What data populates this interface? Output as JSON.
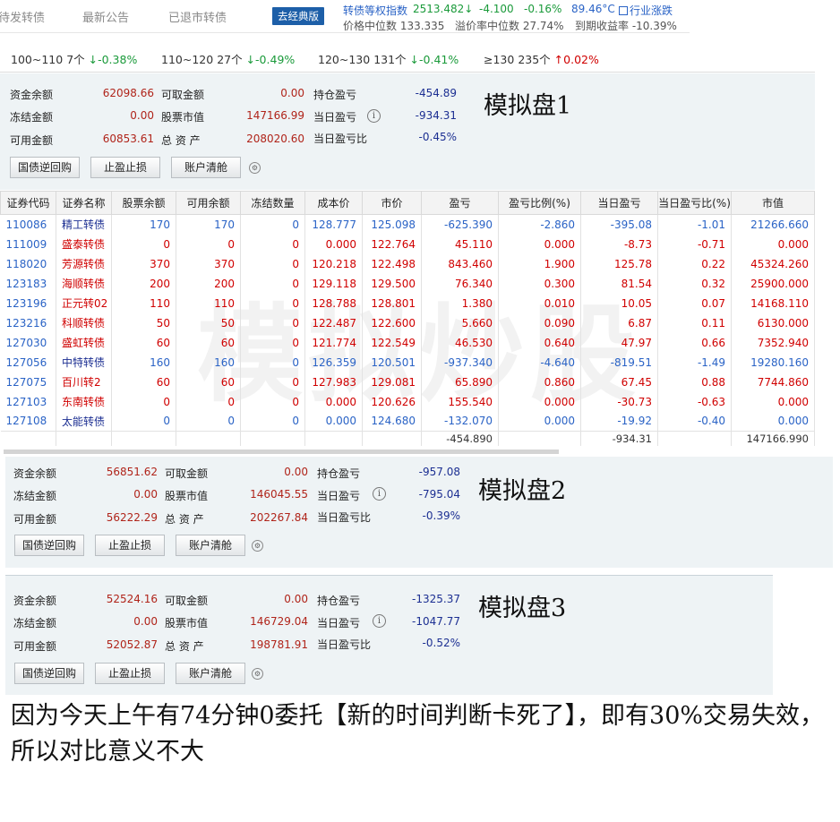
{
  "nav": {
    "tabs": [
      "待发转债",
      "最新公告",
      "已退市转债"
    ],
    "classic_button": "去经典版"
  },
  "index": {
    "label": "转债等权指数",
    "value": "2513.482↓",
    "change": "-4.100",
    "change_pct": "-0.16%",
    "temperature": "89.46°C",
    "industry_link": "行业涨跌",
    "median_price_label": "价格中位数 133.335",
    "premium_label": "溢价率中位数 27.74%",
    "ytm_label": "到期收益率 -10.39%"
  },
  "distribution": [
    {
      "range": "100~110",
      "count": "7个",
      "change": "↓-0.38%",
      "dir": "down"
    },
    {
      "range": "110~120",
      "count": "27个",
      "change": "↓-0.49%",
      "dir": "down"
    },
    {
      "range": "120~130",
      "count": "131个",
      "change": "↓-0.41%",
      "dir": "down"
    },
    {
      "range": "≥130",
      "count": "235个",
      "change": "↑0.02%",
      "dir": "up"
    }
  ],
  "labels": {
    "fund_balance": "资金余额",
    "withdrawable": "可取金额",
    "position_pl": "持仓盈亏",
    "frozen": "冻结金额",
    "stock_value": "股票市值",
    "today_pl": "当日盈亏",
    "available": "可用金额",
    "total_assets": "总 资 产",
    "today_pl_ratio": "当日盈亏比",
    "btn_repo": "国债逆回购",
    "btn_stop": "止盈止损",
    "btn_clear": "账户清舱"
  },
  "panels": [
    {
      "title": "模拟盘1",
      "fund_balance": "62098.66",
      "withdrawable": "0.00",
      "position_pl": "-454.89",
      "frozen": "0.00",
      "stock_value": "147166.99",
      "today_pl": "-934.31",
      "available": "60853.61",
      "total_assets": "208020.60",
      "today_pl_ratio": "-0.45%"
    },
    {
      "title": "模拟盘2",
      "fund_balance": "56851.62",
      "withdrawable": "0.00",
      "position_pl": "-957.08",
      "frozen": "0.00",
      "stock_value": "146045.55",
      "today_pl": "-795.04",
      "available": "56222.29",
      "total_assets": "202267.84",
      "today_pl_ratio": "-0.39%"
    },
    {
      "title": "模拟盘3",
      "fund_balance": "52524.16",
      "withdrawable": "0.00",
      "position_pl": "-1325.37",
      "frozen": "0.00",
      "stock_value": "146729.04",
      "today_pl": "-1047.77",
      "available": "52052.87",
      "total_assets": "198781.91",
      "today_pl_ratio": "-0.52%"
    }
  ],
  "table": {
    "headers": [
      "证券代码",
      "证券名称",
      "股票余额",
      "可用余额",
      "冻结数量",
      "成本价",
      "市价",
      "盈亏",
      "盈亏比例(%)",
      "当日盈亏",
      "当日盈亏比(%)",
      "市值"
    ],
    "rows": [
      {
        "code": "110086",
        "name": "精工转债",
        "bal": "170",
        "avail": "170",
        "frozen": "0",
        "cost": "128.777",
        "price": "125.098",
        "pl": "-625.390",
        "pl_pct": "-2.860",
        "day_pl": "-395.08",
        "day_pct": "-1.01",
        "value": "21266.660",
        "color": "blue"
      },
      {
        "code": "111009",
        "name": "盛泰转债",
        "bal": "0",
        "avail": "0",
        "frozen": "0",
        "cost": "0.000",
        "price": "122.764",
        "pl": "45.110",
        "pl_pct": "0.000",
        "day_pl": "-8.73",
        "day_pct": "-0.71",
        "value": "0.000",
        "color": "red"
      },
      {
        "code": "118020",
        "name": "芳源转债",
        "bal": "370",
        "avail": "370",
        "frozen": "0",
        "cost": "120.218",
        "price": "122.498",
        "pl": "843.460",
        "pl_pct": "1.900",
        "day_pl": "125.78",
        "day_pct": "0.22",
        "value": "45324.260",
        "color": "red"
      },
      {
        "code": "123183",
        "name": "海顺转债",
        "bal": "200",
        "avail": "200",
        "frozen": "0",
        "cost": "129.118",
        "price": "129.500",
        "pl": "76.340",
        "pl_pct": "0.300",
        "day_pl": "81.54",
        "day_pct": "0.32",
        "value": "25900.000",
        "color": "red"
      },
      {
        "code": "123196",
        "name": "正元转02",
        "bal": "110",
        "avail": "110",
        "frozen": "0",
        "cost": "128.788",
        "price": "128.801",
        "pl": "1.380",
        "pl_pct": "0.010",
        "day_pl": "10.05",
        "day_pct": "0.07",
        "value": "14168.110",
        "color": "red"
      },
      {
        "code": "123216",
        "name": "科顺转债",
        "bal": "50",
        "avail": "50",
        "frozen": "0",
        "cost": "122.487",
        "price": "122.600",
        "pl": "5.660",
        "pl_pct": "0.090",
        "day_pl": "6.87",
        "day_pct": "0.11",
        "value": "6130.000",
        "color": "red"
      },
      {
        "code": "127030",
        "name": "盛虹转债",
        "bal": "60",
        "avail": "60",
        "frozen": "0",
        "cost": "121.774",
        "price": "122.549",
        "pl": "46.530",
        "pl_pct": "0.640",
        "day_pl": "47.97",
        "day_pct": "0.66",
        "value": "7352.940",
        "color": "red"
      },
      {
        "code": "127056",
        "name": "中特转债",
        "bal": "160",
        "avail": "160",
        "frozen": "0",
        "cost": "126.359",
        "price": "120.501",
        "pl": "-937.340",
        "pl_pct": "-4.640",
        "day_pl": "-819.51",
        "day_pct": "-1.49",
        "value": "19280.160",
        "color": "blue"
      },
      {
        "code": "127075",
        "name": "百川转2",
        "bal": "60",
        "avail": "60",
        "frozen": "0",
        "cost": "127.983",
        "price": "129.081",
        "pl": "65.890",
        "pl_pct": "0.860",
        "day_pl": "67.45",
        "day_pct": "0.88",
        "value": "7744.860",
        "color": "red"
      },
      {
        "code": "127103",
        "name": "东南转债",
        "bal": "0",
        "avail": "0",
        "frozen": "0",
        "cost": "0.000",
        "price": "120.626",
        "pl": "155.540",
        "pl_pct": "0.000",
        "day_pl": "-30.73",
        "day_pct": "-0.63",
        "value": "0.000",
        "color": "red"
      },
      {
        "code": "127108",
        "name": "太能转债",
        "bal": "0",
        "avail": "0",
        "frozen": "0",
        "cost": "0.000",
        "price": "124.680",
        "pl": "-132.070",
        "pl_pct": "0.000",
        "day_pl": "-19.92",
        "day_pct": "-0.40",
        "value": "0.000",
        "color": "blue"
      }
    ],
    "totals": {
      "pl": "-454.890",
      "day_pl": "-934.31",
      "value": "147166.990"
    }
  },
  "watermark": "模拟炒股",
  "footer_note": "因为今天上午有74分钟0委托【新的时间判断卡死了】，即有30%交易失效，所以对比意义不大",
  "colors": {
    "up": "#d00000",
    "down": "#1a9a3a",
    "blue": "#2a63c6",
    "navy": "#1c2f92",
    "panel_bg": "#eef3f5"
  }
}
